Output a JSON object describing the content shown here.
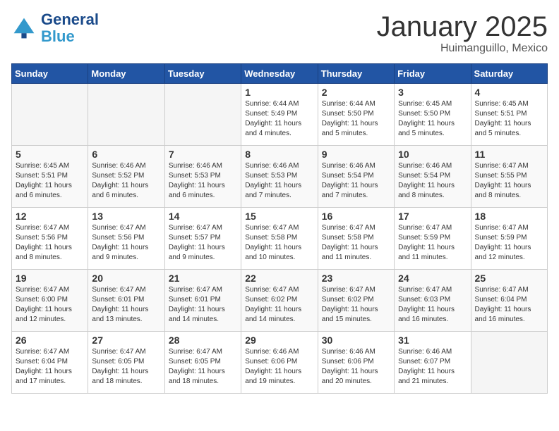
{
  "header": {
    "logo_line1": "General",
    "logo_line2": "Blue",
    "month_title": "January 2025",
    "subtitle": "Huimanguillo, Mexico"
  },
  "days_of_week": [
    "Sunday",
    "Monday",
    "Tuesday",
    "Wednesday",
    "Thursday",
    "Friday",
    "Saturday"
  ],
  "weeks": [
    [
      {
        "day": "",
        "info": ""
      },
      {
        "day": "",
        "info": ""
      },
      {
        "day": "",
        "info": ""
      },
      {
        "day": "1",
        "info": "Sunrise: 6:44 AM\nSunset: 5:49 PM\nDaylight: 11 hours and 4 minutes."
      },
      {
        "day": "2",
        "info": "Sunrise: 6:44 AM\nSunset: 5:50 PM\nDaylight: 11 hours and 5 minutes."
      },
      {
        "day": "3",
        "info": "Sunrise: 6:45 AM\nSunset: 5:50 PM\nDaylight: 11 hours and 5 minutes."
      },
      {
        "day": "4",
        "info": "Sunrise: 6:45 AM\nSunset: 5:51 PM\nDaylight: 11 hours and 5 minutes."
      }
    ],
    [
      {
        "day": "5",
        "info": "Sunrise: 6:45 AM\nSunset: 5:51 PM\nDaylight: 11 hours and 6 minutes."
      },
      {
        "day": "6",
        "info": "Sunrise: 6:46 AM\nSunset: 5:52 PM\nDaylight: 11 hours and 6 minutes."
      },
      {
        "day": "7",
        "info": "Sunrise: 6:46 AM\nSunset: 5:53 PM\nDaylight: 11 hours and 6 minutes."
      },
      {
        "day": "8",
        "info": "Sunrise: 6:46 AM\nSunset: 5:53 PM\nDaylight: 11 hours and 7 minutes."
      },
      {
        "day": "9",
        "info": "Sunrise: 6:46 AM\nSunset: 5:54 PM\nDaylight: 11 hours and 7 minutes."
      },
      {
        "day": "10",
        "info": "Sunrise: 6:46 AM\nSunset: 5:54 PM\nDaylight: 11 hours and 8 minutes."
      },
      {
        "day": "11",
        "info": "Sunrise: 6:47 AM\nSunset: 5:55 PM\nDaylight: 11 hours and 8 minutes."
      }
    ],
    [
      {
        "day": "12",
        "info": "Sunrise: 6:47 AM\nSunset: 5:56 PM\nDaylight: 11 hours and 8 minutes."
      },
      {
        "day": "13",
        "info": "Sunrise: 6:47 AM\nSunset: 5:56 PM\nDaylight: 11 hours and 9 minutes."
      },
      {
        "day": "14",
        "info": "Sunrise: 6:47 AM\nSunset: 5:57 PM\nDaylight: 11 hours and 9 minutes."
      },
      {
        "day": "15",
        "info": "Sunrise: 6:47 AM\nSunset: 5:58 PM\nDaylight: 11 hours and 10 minutes."
      },
      {
        "day": "16",
        "info": "Sunrise: 6:47 AM\nSunset: 5:58 PM\nDaylight: 11 hours and 11 minutes."
      },
      {
        "day": "17",
        "info": "Sunrise: 6:47 AM\nSunset: 5:59 PM\nDaylight: 11 hours and 11 minutes."
      },
      {
        "day": "18",
        "info": "Sunrise: 6:47 AM\nSunset: 5:59 PM\nDaylight: 11 hours and 12 minutes."
      }
    ],
    [
      {
        "day": "19",
        "info": "Sunrise: 6:47 AM\nSunset: 6:00 PM\nDaylight: 11 hours and 12 minutes."
      },
      {
        "day": "20",
        "info": "Sunrise: 6:47 AM\nSunset: 6:01 PM\nDaylight: 11 hours and 13 minutes."
      },
      {
        "day": "21",
        "info": "Sunrise: 6:47 AM\nSunset: 6:01 PM\nDaylight: 11 hours and 14 minutes."
      },
      {
        "day": "22",
        "info": "Sunrise: 6:47 AM\nSunset: 6:02 PM\nDaylight: 11 hours and 14 minutes."
      },
      {
        "day": "23",
        "info": "Sunrise: 6:47 AM\nSunset: 6:02 PM\nDaylight: 11 hours and 15 minutes."
      },
      {
        "day": "24",
        "info": "Sunrise: 6:47 AM\nSunset: 6:03 PM\nDaylight: 11 hours and 16 minutes."
      },
      {
        "day": "25",
        "info": "Sunrise: 6:47 AM\nSunset: 6:04 PM\nDaylight: 11 hours and 16 minutes."
      }
    ],
    [
      {
        "day": "26",
        "info": "Sunrise: 6:47 AM\nSunset: 6:04 PM\nDaylight: 11 hours and 17 minutes."
      },
      {
        "day": "27",
        "info": "Sunrise: 6:47 AM\nSunset: 6:05 PM\nDaylight: 11 hours and 18 minutes."
      },
      {
        "day": "28",
        "info": "Sunrise: 6:47 AM\nSunset: 6:05 PM\nDaylight: 11 hours and 18 minutes."
      },
      {
        "day": "29",
        "info": "Sunrise: 6:46 AM\nSunset: 6:06 PM\nDaylight: 11 hours and 19 minutes."
      },
      {
        "day": "30",
        "info": "Sunrise: 6:46 AM\nSunset: 6:06 PM\nDaylight: 11 hours and 20 minutes."
      },
      {
        "day": "31",
        "info": "Sunrise: 6:46 AM\nSunset: 6:07 PM\nDaylight: 11 hours and 21 minutes."
      },
      {
        "day": "",
        "info": ""
      }
    ]
  ]
}
